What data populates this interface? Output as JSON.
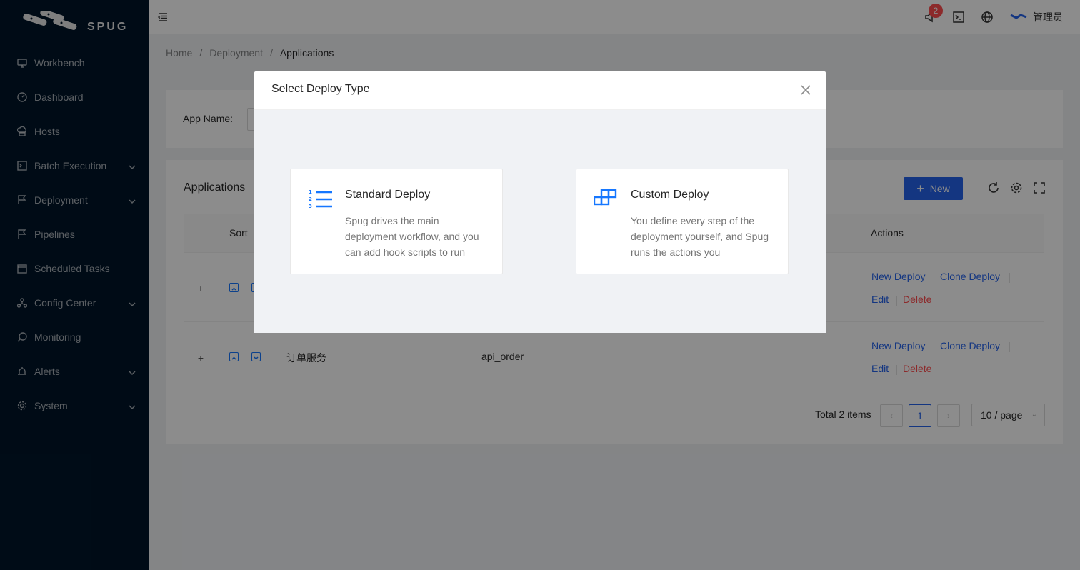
{
  "brand": {
    "name": "SPUG"
  },
  "sidebar": {
    "items": [
      {
        "label": "Workbench",
        "icon": "desktop-icon",
        "has_children": false
      },
      {
        "label": "Dashboard",
        "icon": "dashboard-icon",
        "has_children": false
      },
      {
        "label": "Hosts",
        "icon": "cloud-server-icon",
        "has_children": false
      },
      {
        "label": "Batch Execution",
        "icon": "code-icon",
        "has_children": true
      },
      {
        "label": "Deployment",
        "icon": "flag-icon",
        "has_children": true
      },
      {
        "label": "Pipelines",
        "icon": "pipeline-icon",
        "has_children": false
      },
      {
        "label": "Scheduled Tasks",
        "icon": "schedule-icon",
        "has_children": false
      },
      {
        "label": "Config Center",
        "icon": "cluster-icon",
        "has_children": true
      },
      {
        "label": "Monitoring",
        "icon": "monitor-icon",
        "has_children": false
      },
      {
        "label": "Alerts",
        "icon": "alert-icon",
        "has_children": true
      },
      {
        "label": "System",
        "icon": "setting-icon",
        "has_children": true
      }
    ]
  },
  "header": {
    "notification_count": "2",
    "user_name": "管理员"
  },
  "breadcrumb": [
    "Home",
    "Deployment",
    "Applications"
  ],
  "filter": {
    "label": "App Name",
    "colon": ":"
  },
  "table": {
    "title": "Applications",
    "new_button": "New",
    "columns": {
      "sort": "Sort",
      "actions": "Actions"
    },
    "rows": [
      {
        "name": "",
        "key": "",
        "actions": [
          "New Deploy",
          "Clone Deploy",
          "Edit",
          "Delete"
        ]
      },
      {
        "name": "订单服务",
        "key": "api_order",
        "actions": [
          "New Deploy",
          "Clone Deploy",
          "Edit",
          "Delete"
        ]
      }
    ],
    "pagination": {
      "total": "Total 2 items",
      "current_page": "1",
      "page_size": "10 / page"
    }
  },
  "modal": {
    "title": "Select Deploy Type",
    "options": [
      {
        "title": "Standard Deploy",
        "description": "Spug drives the main deployment workflow, and you can add hook scripts to run",
        "icon": "ordered-list-icon"
      },
      {
        "title": "Custom Deploy",
        "description": "You define every step of the deployment yourself, and Spug runs the actions you",
        "icon": "build-blocks-icon"
      }
    ]
  },
  "colors": {
    "primary": "#2563eb",
    "sidebar_bg": "#001529",
    "danger": "#ff4d4f"
  }
}
